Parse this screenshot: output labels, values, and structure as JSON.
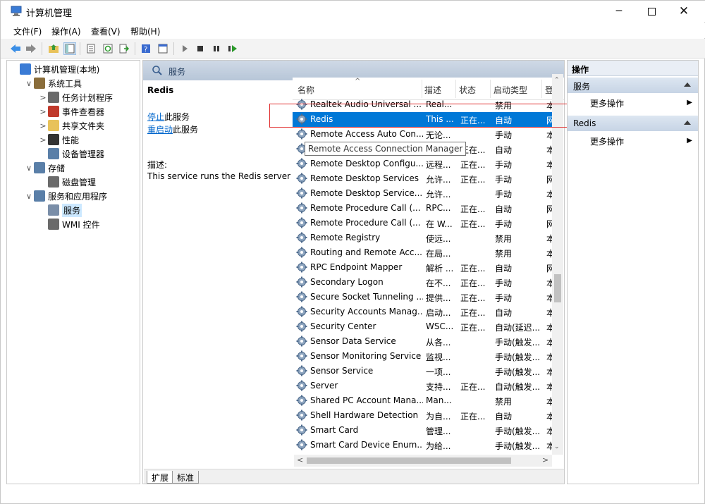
{
  "window": {
    "title": "计算机管理",
    "controls": [
      "minimize-icon",
      "maximize-icon",
      "close-icon"
    ]
  },
  "menu": [
    "文件(F)",
    "操作(A)",
    "查看(V)",
    "帮助(H)"
  ],
  "toolbar_icons": [
    "back-icon",
    "forward-icon",
    "up-folder-icon",
    "show-hide-tree-icon",
    "properties-icon",
    "refresh-icon",
    "export-icon",
    "help-icon",
    "console-icon",
    "play-icon",
    "stop-icon",
    "pause-icon",
    "restart-icon"
  ],
  "tree": [
    {
      "label": "计算机管理(本地)",
      "level": 0,
      "expander": ""
    },
    {
      "label": "系统工具",
      "level": 1,
      "expander": "∨"
    },
    {
      "label": "任务计划程序",
      "level": 2,
      "expander": ">"
    },
    {
      "label": "事件查看器",
      "level": 2,
      "expander": ">"
    },
    {
      "label": "共享文件夹",
      "level": 2,
      "expander": ">"
    },
    {
      "label": "性能",
      "level": 2,
      "expander": ">"
    },
    {
      "label": "设备管理器",
      "level": 2,
      "expander": ""
    },
    {
      "label": "存储",
      "level": 1,
      "expander": "∨"
    },
    {
      "label": "磁盘管理",
      "level": 2,
      "expander": ""
    },
    {
      "label": "服务和应用程序",
      "level": 1,
      "expander": "∨"
    },
    {
      "label": "服务",
      "level": 2,
      "expander": "",
      "selected": true
    },
    {
      "label": "WMI 控件",
      "level": 2,
      "expander": ""
    }
  ],
  "center": {
    "header": "服务",
    "service_name": "Redis",
    "stop_link": "停止",
    "stop_suffix": "此服务",
    "restart_link": "重启动",
    "restart_suffix": "此服务",
    "desc_label": "描述:",
    "desc_text": "This service runs the Redis server"
  },
  "columns": [
    "名称",
    "描述",
    "状态",
    "启动类型",
    "登"
  ],
  "rows": [
    {
      "name": "Realtek Audio Universal ...",
      "desc": "Real...",
      "status": "",
      "startup": "禁用",
      "logon": "本"
    },
    {
      "name": "Redis",
      "desc": "This ...",
      "status": "正在...",
      "startup": "自动",
      "logon": "网",
      "selected": true
    },
    {
      "name": "Remote Access Auto Con...",
      "desc": "无论...",
      "status": "",
      "startup": "手动",
      "logon": "本"
    },
    {
      "name": "Remote Access Connection Manager",
      "desc": "",
      "status": "正在...",
      "startup": "自动",
      "logon": "本"
    },
    {
      "name": "Remote Desktop Configu...",
      "desc": "远程...",
      "status": "正在...",
      "startup": "手动",
      "logon": "本"
    },
    {
      "name": "Remote Desktop Services",
      "desc": "允许...",
      "status": "正在...",
      "startup": "手动",
      "logon": "网"
    },
    {
      "name": "Remote Desktop Service...",
      "desc": "允许...",
      "status": "",
      "startup": "手动",
      "logon": "本"
    },
    {
      "name": "Remote Procedure Call (...",
      "desc": "RPC...",
      "status": "正在...",
      "startup": "自动",
      "logon": "网"
    },
    {
      "name": "Remote Procedure Call (...",
      "desc": "在 W...",
      "status": "正在...",
      "startup": "手动",
      "logon": "网"
    },
    {
      "name": "Remote Registry",
      "desc": "使远...",
      "status": "",
      "startup": "禁用",
      "logon": "本"
    },
    {
      "name": "Routing and Remote Acc...",
      "desc": "在局...",
      "status": "",
      "startup": "禁用",
      "logon": "本"
    },
    {
      "name": "RPC Endpoint Mapper",
      "desc": "解析 ...",
      "status": "正在...",
      "startup": "自动",
      "logon": "网"
    },
    {
      "name": "Secondary Logon",
      "desc": "在不...",
      "status": "正在...",
      "startup": "手动",
      "logon": "本"
    },
    {
      "name": "Secure Socket Tunneling ...",
      "desc": "提供...",
      "status": "正在...",
      "startup": "手动",
      "logon": "本"
    },
    {
      "name": "Security Accounts Manag...",
      "desc": "启动...",
      "status": "正在...",
      "startup": "自动",
      "logon": "本"
    },
    {
      "name": "Security Center",
      "desc": "WSC...",
      "status": "正在...",
      "startup": "自动(延迟...",
      "logon": "本"
    },
    {
      "name": "Sensor Data Service",
      "desc": "从各...",
      "status": "",
      "startup": "手动(触发...",
      "logon": "本"
    },
    {
      "name": "Sensor Monitoring Service",
      "desc": "监视...",
      "status": "",
      "startup": "手动(触发...",
      "logon": "本"
    },
    {
      "name": "Sensor Service",
      "desc": "一项...",
      "status": "",
      "startup": "手动(触发...",
      "logon": "本"
    },
    {
      "name": "Server",
      "desc": "支持...",
      "status": "正在...",
      "startup": "自动(触发...",
      "logon": "本"
    },
    {
      "name": "Shared PC Account Mana...",
      "desc": "Man...",
      "status": "",
      "startup": "禁用",
      "logon": "本"
    },
    {
      "name": "Shell Hardware Detection",
      "desc": "为自...",
      "status": "正在...",
      "startup": "自动",
      "logon": "本"
    },
    {
      "name": "Smart Card",
      "desc": "管理...",
      "status": "",
      "startup": "手动(触发...",
      "logon": "本"
    },
    {
      "name": "Smart Card Device Enum...",
      "desc": "为给...",
      "status": "",
      "startup": "手动(触发...",
      "logon": "本"
    }
  ],
  "tooltip": "Remote Access Connection Manager",
  "tabs": [
    "扩展",
    "标准"
  ],
  "actions": {
    "header": "操作",
    "sections": [
      {
        "title": "服务",
        "item": "更多操作"
      },
      {
        "title": "Redis",
        "item": "更多操作"
      }
    ]
  },
  "colors": {
    "selection": "#0078d7",
    "link": "#0066cc",
    "highlight_box": "#e03030"
  }
}
